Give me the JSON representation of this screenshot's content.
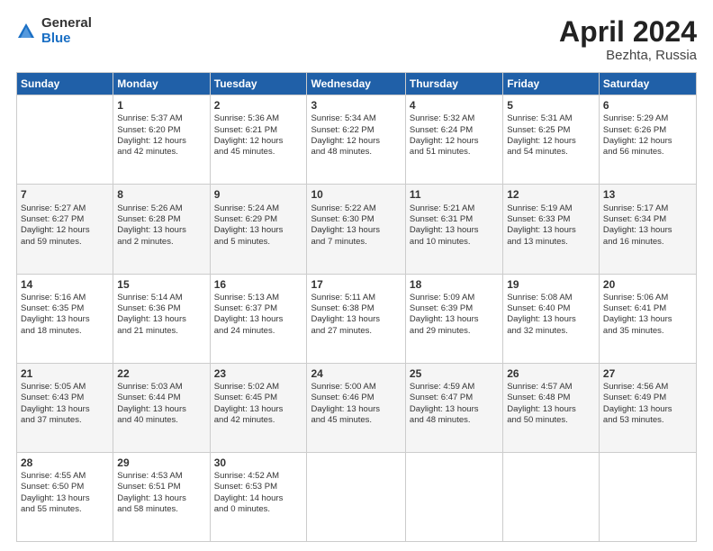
{
  "logo": {
    "general": "General",
    "blue": "Blue"
  },
  "header": {
    "title": "April 2024",
    "subtitle": "Bezhta, Russia"
  },
  "days_of_week": [
    "Sunday",
    "Monday",
    "Tuesday",
    "Wednesday",
    "Thursday",
    "Friday",
    "Saturday"
  ],
  "weeks": [
    [
      {
        "day": "",
        "info": ""
      },
      {
        "day": "1",
        "info": "Sunrise: 5:37 AM\nSunset: 6:20 PM\nDaylight: 12 hours\nand 42 minutes."
      },
      {
        "day": "2",
        "info": "Sunrise: 5:36 AM\nSunset: 6:21 PM\nDaylight: 12 hours\nand 45 minutes."
      },
      {
        "day": "3",
        "info": "Sunrise: 5:34 AM\nSunset: 6:22 PM\nDaylight: 12 hours\nand 48 minutes."
      },
      {
        "day": "4",
        "info": "Sunrise: 5:32 AM\nSunset: 6:24 PM\nDaylight: 12 hours\nand 51 minutes."
      },
      {
        "day": "5",
        "info": "Sunrise: 5:31 AM\nSunset: 6:25 PM\nDaylight: 12 hours\nand 54 minutes."
      },
      {
        "day": "6",
        "info": "Sunrise: 5:29 AM\nSunset: 6:26 PM\nDaylight: 12 hours\nand 56 minutes."
      }
    ],
    [
      {
        "day": "7",
        "info": "Sunrise: 5:27 AM\nSunset: 6:27 PM\nDaylight: 12 hours\nand 59 minutes."
      },
      {
        "day": "8",
        "info": "Sunrise: 5:26 AM\nSunset: 6:28 PM\nDaylight: 13 hours\nand 2 minutes."
      },
      {
        "day": "9",
        "info": "Sunrise: 5:24 AM\nSunset: 6:29 PM\nDaylight: 13 hours\nand 5 minutes."
      },
      {
        "day": "10",
        "info": "Sunrise: 5:22 AM\nSunset: 6:30 PM\nDaylight: 13 hours\nand 7 minutes."
      },
      {
        "day": "11",
        "info": "Sunrise: 5:21 AM\nSunset: 6:31 PM\nDaylight: 13 hours\nand 10 minutes."
      },
      {
        "day": "12",
        "info": "Sunrise: 5:19 AM\nSunset: 6:33 PM\nDaylight: 13 hours\nand 13 minutes."
      },
      {
        "day": "13",
        "info": "Sunrise: 5:17 AM\nSunset: 6:34 PM\nDaylight: 13 hours\nand 16 minutes."
      }
    ],
    [
      {
        "day": "14",
        "info": "Sunrise: 5:16 AM\nSunset: 6:35 PM\nDaylight: 13 hours\nand 18 minutes."
      },
      {
        "day": "15",
        "info": "Sunrise: 5:14 AM\nSunset: 6:36 PM\nDaylight: 13 hours\nand 21 minutes."
      },
      {
        "day": "16",
        "info": "Sunrise: 5:13 AM\nSunset: 6:37 PM\nDaylight: 13 hours\nand 24 minutes."
      },
      {
        "day": "17",
        "info": "Sunrise: 5:11 AM\nSunset: 6:38 PM\nDaylight: 13 hours\nand 27 minutes."
      },
      {
        "day": "18",
        "info": "Sunrise: 5:09 AM\nSunset: 6:39 PM\nDaylight: 13 hours\nand 29 minutes."
      },
      {
        "day": "19",
        "info": "Sunrise: 5:08 AM\nSunset: 6:40 PM\nDaylight: 13 hours\nand 32 minutes."
      },
      {
        "day": "20",
        "info": "Sunrise: 5:06 AM\nSunset: 6:41 PM\nDaylight: 13 hours\nand 35 minutes."
      }
    ],
    [
      {
        "day": "21",
        "info": "Sunrise: 5:05 AM\nSunset: 6:43 PM\nDaylight: 13 hours\nand 37 minutes."
      },
      {
        "day": "22",
        "info": "Sunrise: 5:03 AM\nSunset: 6:44 PM\nDaylight: 13 hours\nand 40 minutes."
      },
      {
        "day": "23",
        "info": "Sunrise: 5:02 AM\nSunset: 6:45 PM\nDaylight: 13 hours\nand 42 minutes."
      },
      {
        "day": "24",
        "info": "Sunrise: 5:00 AM\nSunset: 6:46 PM\nDaylight: 13 hours\nand 45 minutes."
      },
      {
        "day": "25",
        "info": "Sunrise: 4:59 AM\nSunset: 6:47 PM\nDaylight: 13 hours\nand 48 minutes."
      },
      {
        "day": "26",
        "info": "Sunrise: 4:57 AM\nSunset: 6:48 PM\nDaylight: 13 hours\nand 50 minutes."
      },
      {
        "day": "27",
        "info": "Sunrise: 4:56 AM\nSunset: 6:49 PM\nDaylight: 13 hours\nand 53 minutes."
      }
    ],
    [
      {
        "day": "28",
        "info": "Sunrise: 4:55 AM\nSunset: 6:50 PM\nDaylight: 13 hours\nand 55 minutes."
      },
      {
        "day": "29",
        "info": "Sunrise: 4:53 AM\nSunset: 6:51 PM\nDaylight: 13 hours\nand 58 minutes."
      },
      {
        "day": "30",
        "info": "Sunrise: 4:52 AM\nSunset: 6:53 PM\nDaylight: 14 hours\nand 0 minutes."
      },
      {
        "day": "",
        "info": ""
      },
      {
        "day": "",
        "info": ""
      },
      {
        "day": "",
        "info": ""
      },
      {
        "day": "",
        "info": ""
      }
    ]
  ]
}
